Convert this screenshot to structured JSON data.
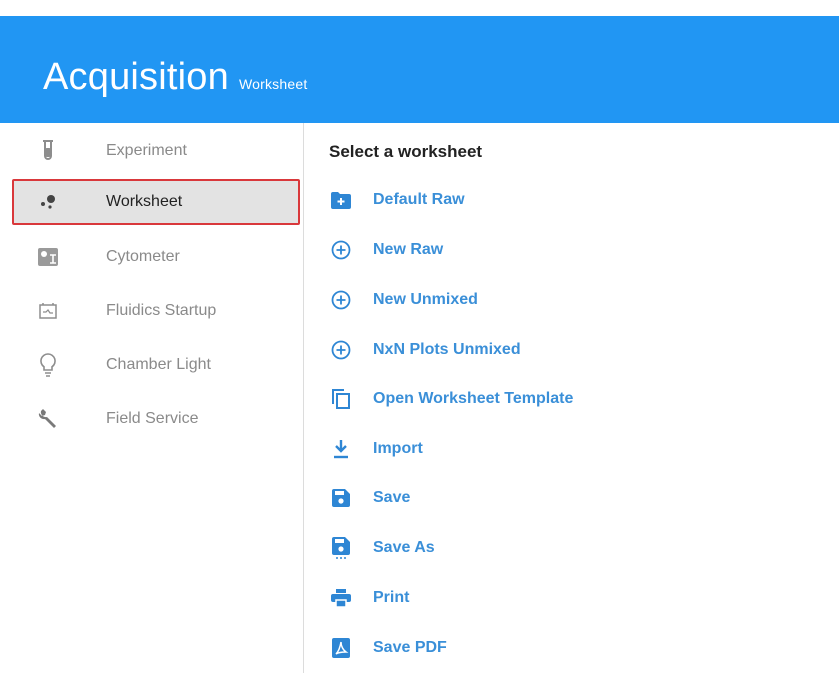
{
  "header": {
    "title": "Acquisition",
    "subtitle": "Worksheet",
    "color": "#2196f3"
  },
  "sidebar": {
    "items": [
      {
        "label": "Experiment",
        "icon": "test-tube-icon",
        "active": false
      },
      {
        "label": "Worksheet",
        "icon": "scatter-dots-icon",
        "active": true
      },
      {
        "label": "Cytometer",
        "icon": "cytometer-icon",
        "active": false
      },
      {
        "label": "Fluidics Startup",
        "icon": "fluidics-icon",
        "active": false
      },
      {
        "label": "Chamber Light",
        "icon": "lightbulb-icon",
        "active": false
      },
      {
        "label": "Field Service",
        "icon": "wrench-icon",
        "active": false
      }
    ]
  },
  "main": {
    "title": "Select a worksheet",
    "actions": [
      {
        "label": "Default Raw",
        "icon": "folder-plus-icon"
      },
      {
        "label": "New Raw",
        "icon": "plus-circle-icon"
      },
      {
        "label": "New Unmixed",
        "icon": "plus-circle-icon"
      },
      {
        "label": "NxN Plots Unmixed",
        "icon": "plus-circle-icon"
      },
      {
        "label": "Open Worksheet Template",
        "icon": "copy-icon"
      },
      {
        "label": "Import",
        "icon": "download-icon"
      },
      {
        "label": "Save",
        "icon": "floppy-icon"
      },
      {
        "label": "Save As",
        "icon": "floppy-more-icon"
      },
      {
        "label": "Print",
        "icon": "printer-icon"
      },
      {
        "label": "Save PDF",
        "icon": "pdf-icon"
      }
    ],
    "accent": "#3a8fd8"
  }
}
